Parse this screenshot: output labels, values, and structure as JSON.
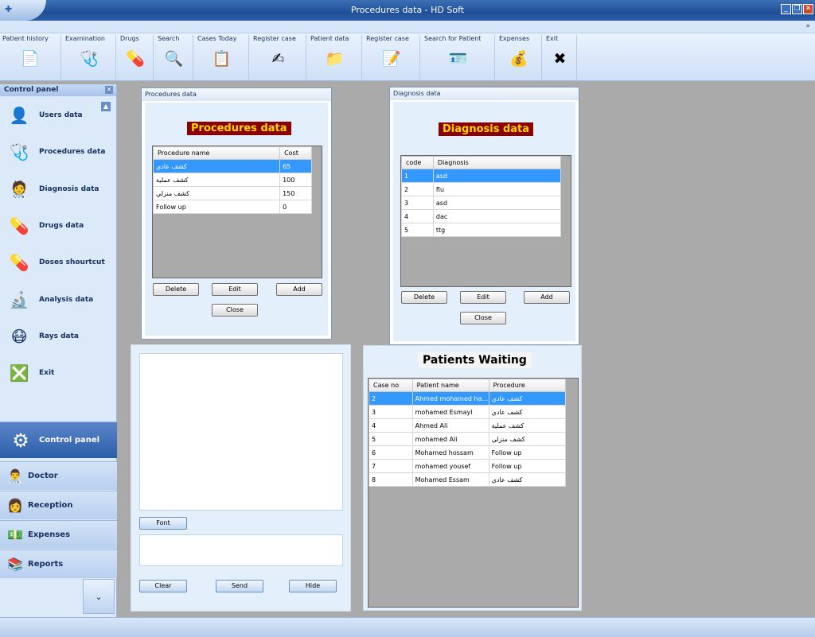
{
  "window": {
    "title": "Procedures data - HD Soft",
    "orb_icon": "app-orb-icon"
  },
  "ribbon": {
    "collapse_glyph": "»"
  },
  "toolbar": [
    {
      "label": "Patient history",
      "icon": "📄"
    },
    {
      "label": "Examination",
      "icon": "🩺"
    },
    {
      "label": "Drugs",
      "icon": "💊"
    },
    {
      "label": "Search",
      "icon": "🔍"
    },
    {
      "label": "Cases Today",
      "icon": "📋"
    },
    {
      "label": "Register case",
      "icon": "✍"
    },
    {
      "label": "Patient  data",
      "icon": "📁"
    },
    {
      "label": "Register case",
      "icon": "📝"
    },
    {
      "label": "Search for  Patient",
      "icon": "🪪"
    },
    {
      "label": "Expenses",
      "icon": "💰"
    },
    {
      "label": "Exit",
      "icon": "✖"
    }
  ],
  "control_panel": {
    "title": "Control panel",
    "items": [
      {
        "label": "Users data",
        "icon": "👤"
      },
      {
        "label": "Procedures data",
        "icon": "🩺"
      },
      {
        "label": "Diagnosis data",
        "icon": "🧑‍⚕️"
      },
      {
        "label": "Drugs data",
        "icon": "💊"
      },
      {
        "label": "Doses shourtcut",
        "icon": "💊"
      },
      {
        "label": "Analysis data",
        "icon": "🔬"
      },
      {
        "label": "Rays data",
        "icon": "😷"
      },
      {
        "label": "Exit",
        "icon": "❎"
      }
    ]
  },
  "nav": [
    {
      "label": "Control panel",
      "icon": "⚙"
    },
    {
      "label": "Doctor",
      "icon": "👨‍⚕️"
    },
    {
      "label": "Reception",
      "icon": "👩"
    },
    {
      "label": "Expenses",
      "icon": "💵"
    },
    {
      "label": "Reports",
      "icon": "📚"
    }
  ],
  "procedures": {
    "window_title": "Procedures data",
    "heading": "Procedures data",
    "columns": [
      "Procedure name",
      "Cost"
    ],
    "rows": [
      [
        "كشف عادي",
        "65"
      ],
      [
        "كشف عملية",
        "100"
      ],
      [
        "كشف منزلي",
        "150"
      ],
      [
        "Follow up",
        "0"
      ]
    ],
    "buttons": {
      "delete": "Delete",
      "edit": "Edit",
      "add": "Add",
      "close": "Close"
    }
  },
  "diagnosis": {
    "window_title": "Diagnosis data",
    "heading": "Diagnosis data",
    "columns": [
      "code",
      "Diagnosis"
    ],
    "rows": [
      [
        "1",
        "asd"
      ],
      [
        "2",
        "flu"
      ],
      [
        "3",
        "asd"
      ],
      [
        "4",
        "dac"
      ],
      [
        "5",
        "ttg"
      ]
    ],
    "buttons": {
      "delete": "Delete",
      "edit": "Edit",
      "add": "Add",
      "close": "Close"
    }
  },
  "chat": {
    "font_button": "Font",
    "clear_button": "Clear",
    "send_button": "Send",
    "hide_button": "Hide"
  },
  "waiting": {
    "heading": "Patients Waiting",
    "columns": [
      "Case no",
      "Patient name",
      "Procedure"
    ],
    "rows": [
      [
        "2",
        "Ahmed mohamed ha...",
        "كشف عادي"
      ],
      [
        "3",
        "mohamed Esmayl",
        "كشف عادي"
      ],
      [
        "4",
        "Ahmed Ali",
        "كشف عملية"
      ],
      [
        "5",
        "mohamed Ali",
        "كشف منزلي"
      ],
      [
        "6",
        "Mohamed hossam",
        "Follow up"
      ],
      [
        "7",
        "mohamed yousef",
        "Follow up"
      ],
      [
        "8",
        "Mohamed Essam",
        "كشف عادي"
      ]
    ]
  },
  "colors": {
    "heading_bg": "#8b0000",
    "heading_fg": "#ffd700",
    "selection": "#3399ff"
  }
}
